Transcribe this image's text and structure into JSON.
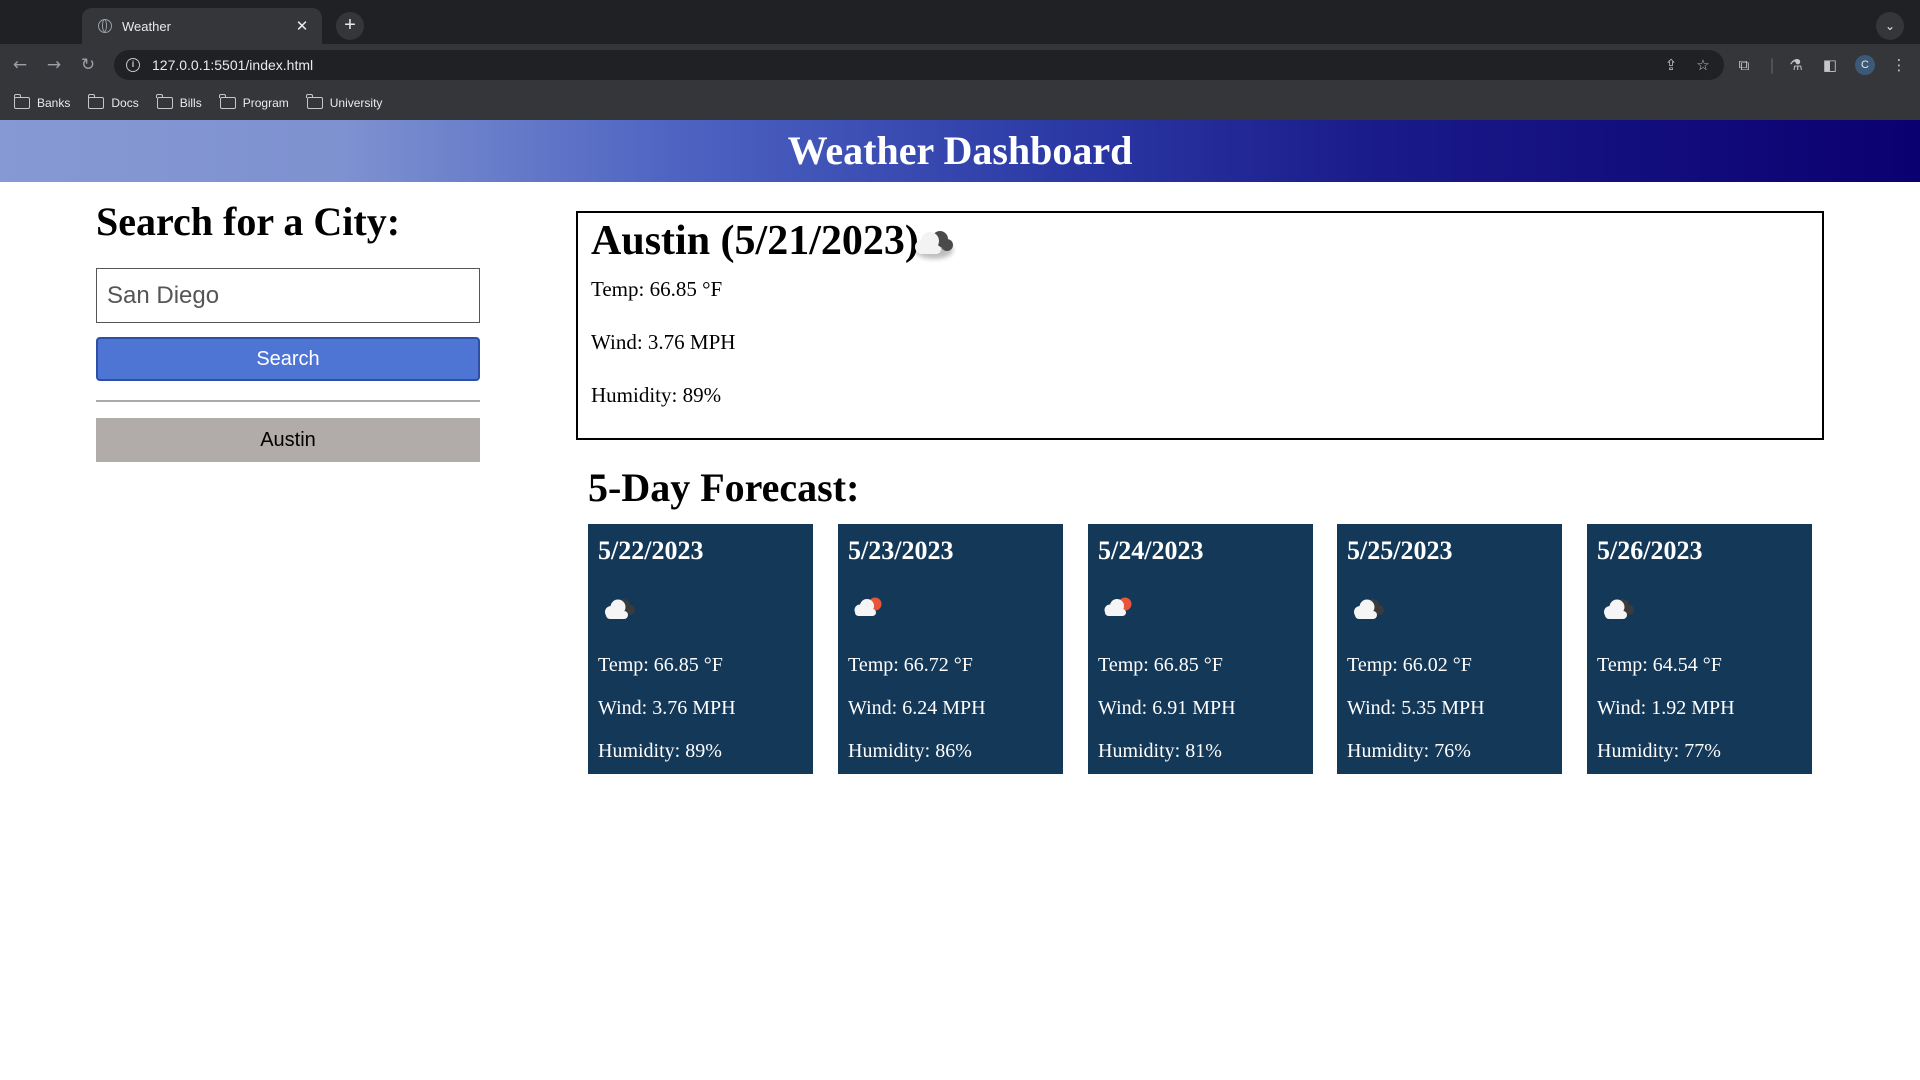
{
  "browser": {
    "tab_title": "Weather",
    "tab_close": "✕",
    "new_tab": "+",
    "url": "127.0.0.1:5501/index.html",
    "profile_initial": "C",
    "bookmarks": [
      "Banks",
      "Docs",
      "Bills",
      "Program",
      "University"
    ]
  },
  "header": {
    "title": "Weather Dashboard"
  },
  "search": {
    "heading": "Search for a City:",
    "input_value": "San Diego",
    "button_label": "Search",
    "history": [
      "Austin"
    ]
  },
  "current": {
    "title": "Austin (5/21/2023)",
    "icon": "cloud-icon",
    "temp": "Temp: 66.85 °F",
    "wind": "Wind: 3.76 MPH",
    "humidity": "Humidity: 89%"
  },
  "forecast": {
    "heading": "5-Day Forecast:",
    "days": [
      {
        "date": "5/22/2023",
        "icon": "broken-clouds-icon",
        "temp": "Temp: 66.85 °F",
        "wind": "Wind: 3.76 MPH",
        "humidity": "Humidity: 89%"
      },
      {
        "date": "5/23/2023",
        "icon": "few-clouds-icon",
        "temp": "Temp: 66.72 °F",
        "wind": "Wind: 6.24 MPH",
        "humidity": "Humidity: 86%"
      },
      {
        "date": "5/24/2023",
        "icon": "few-clouds-icon",
        "temp": "Temp: 66.85 °F",
        "wind": "Wind: 6.91 MPH",
        "humidity": "Humidity: 81%"
      },
      {
        "date": "5/25/2023",
        "icon": "broken-clouds-icon",
        "temp": "Temp: 66.02 °F",
        "wind": "Wind: 5.35 MPH",
        "humidity": "Humidity: 76%"
      },
      {
        "date": "5/26/2023",
        "icon": "broken-clouds-icon",
        "temp": "Temp: 64.54 °F",
        "wind": "Wind: 1.92 MPH",
        "humidity": "Humidity: 77%"
      }
    ]
  },
  "colors": {
    "header_gradient_start": "#8799d4",
    "header_gradient_end": "#0b0070",
    "search_button": "#4e74d4",
    "history_button": "#b1abaa",
    "forecast_card": "#143858"
  }
}
